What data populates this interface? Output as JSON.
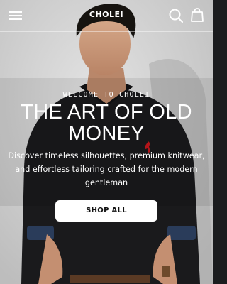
{
  "header": {
    "brand": "CHOLEI",
    "menu_icon": "hamburger-menu-icon",
    "search_icon": "search-icon",
    "cart_icon": "shopping-bag-icon"
  },
  "hero": {
    "eyebrow": "WELCOME TO CHOLEI",
    "title": "THE ART OF OLD MONEY",
    "subtitle": "Discover timeless silhouettes, premium knitwear, and effortless tailoring crafted for the modern gentleman",
    "cta_label": "SHOP ALL"
  },
  "colors": {
    "text": "#ffffff",
    "button_bg": "#ffffff",
    "button_text": "#111111",
    "sweater": "#1a1a1c",
    "logo_accent": "#c4161c"
  }
}
